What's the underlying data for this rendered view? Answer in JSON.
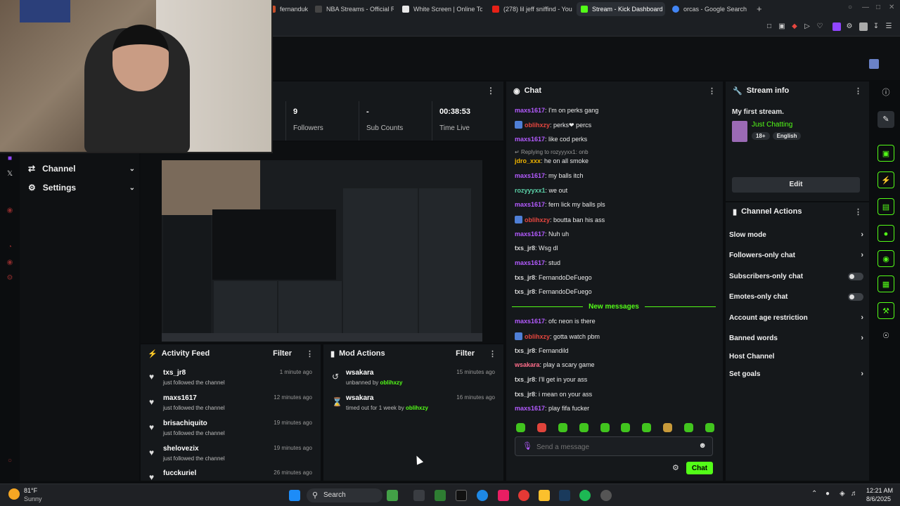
{
  "browser": {
    "tabs": [
      {
        "label": "fernanduk",
        "color": "#c74f2b"
      },
      {
        "label": "NBA Streams - Official Re",
        "color": "#333"
      },
      {
        "label": "White Screen | Online To",
        "color": "#e8e8e8"
      },
      {
        "label": "(278) lil jeff sniffind - You",
        "color": "#e62117"
      },
      {
        "label": "Stream - Kick Dashboard",
        "color": "#53fc18"
      },
      {
        "label": "orcas - Google Search",
        "color": "#4285f4"
      }
    ],
    "new_tab": "+"
  },
  "sidenav": {
    "channel": "Channel",
    "settings": "Settings"
  },
  "stats": [
    {
      "value": "9",
      "label": "Followers"
    },
    {
      "value": "-",
      "label": "Sub Counts"
    },
    {
      "value": "00:38:53",
      "label": "Time Live"
    }
  ],
  "activity_feed": {
    "title": "Activity Feed",
    "filter": "Filter",
    "items": [
      {
        "name": "txs_jr8",
        "sub": "just followed the channel",
        "time": "1 minute ago"
      },
      {
        "name": "maxs1617",
        "sub": "just followed the channel",
        "time": "12 minutes ago"
      },
      {
        "name": "brisachiquito",
        "sub": "just followed the channel",
        "time": "19 minutes ago"
      },
      {
        "name": "shelovezix",
        "sub": "just followed the channel",
        "time": "19 minutes ago"
      },
      {
        "name": "fucckuriel",
        "sub": "",
        "time": "26 minutes ago"
      }
    ]
  },
  "mod_actions": {
    "title": "Mod Actions",
    "filter": "Filter",
    "items": [
      {
        "name": "wsakara",
        "action": "unbanned by",
        "by": "oblihxzy",
        "time": "15 minutes ago"
      },
      {
        "name": "wsakara",
        "action": "timed out for 1 week by",
        "by": "oblihxzy",
        "time": "16 minutes ago"
      }
    ]
  },
  "chat": {
    "title": "Chat",
    "new_messages": "New messages",
    "reply_note": "Replying to rozyyyxx1: onb",
    "placeholder": "Send a message",
    "send_label": "Chat",
    "messages": [
      {
        "user": "maxs1617",
        "text": ": I'm on perks gang",
        "color": "#b45bff",
        "badge": false
      },
      {
        "user": "oblihxzy",
        "text": ": perks❤ percs",
        "color": "#e6463f",
        "badge": true
      },
      {
        "user": "maxs1617",
        "text": ": like cod perks",
        "color": "#b45bff",
        "badge": false
      },
      {
        "user": "jdro_xxx",
        "text": ": he on all smoke",
        "color": "#f0b400",
        "badge": false
      },
      {
        "user": "maxs1617",
        "text": ": my balls itch",
        "color": "#b45bff",
        "badge": false
      },
      {
        "user": "rozyyyxx1",
        "text": ": we out",
        "color": "#5bd1a8",
        "badge": false
      },
      {
        "user": "maxs1617",
        "text": ": fern lick my balls pls",
        "color": "#b45bff",
        "badge": false
      },
      {
        "user": "oblihxzy",
        "text": ": boutta ban his ass",
        "color": "#e6463f",
        "badge": true
      },
      {
        "user": "maxs1617",
        "text": ": Nuh uh",
        "color": "#b45bff",
        "badge": false
      },
      {
        "user": "txs_jr8",
        "text": ": Wsg dl",
        "color": "#d9d9d9",
        "badge": false
      },
      {
        "user": "maxs1617",
        "text": ": stud",
        "color": "#b45bff",
        "badge": false
      },
      {
        "user": "txs_jr8",
        "text": ": FernandoDeFuego",
        "color": "#d9d9d9",
        "badge": false
      },
      {
        "user": "txs_jr8",
        "text": ": FernandoDeFuego",
        "color": "#d9d9d9",
        "badge": false
      },
      {
        "user": "maxs1617",
        "text": ": ofc neon is there",
        "color": "#b45bff",
        "badge": false
      },
      {
        "user": "oblihxzy",
        "text": ": gotta watch pbm",
        "color": "#e6463f",
        "badge": true
      },
      {
        "user": "txs_jr8",
        "text": ": Fernandild",
        "color": "#d9d9d9",
        "badge": false
      },
      {
        "user": "wsakara",
        "text": ": play a scary game",
        "color": "#ff6d8a",
        "badge": false
      },
      {
        "user": "txs_jr8",
        "text": ": I'll get in your ass",
        "color": "#d9d9d9",
        "badge": false
      },
      {
        "user": "txs_jr8",
        "text": ": i mean on your ass",
        "color": "#d9d9d9",
        "badge": false
      },
      {
        "user": "maxs1617",
        "text": ": play fifa fucker",
        "color": "#b45bff",
        "badge": false
      }
    ]
  },
  "stream_info": {
    "title": "Stream info",
    "stream_title": "My first stream.",
    "category": "Just Chatting",
    "tags": [
      "18+",
      "English"
    ],
    "edit": "Edit"
  },
  "channel_actions": {
    "title": "Channel Actions",
    "items": [
      {
        "label": "Slow mode",
        "kind": "chevron"
      },
      {
        "label": "Followers-only chat",
        "kind": "chevron"
      },
      {
        "label": "Subscribers-only chat",
        "kind": "toggle"
      },
      {
        "label": "Emotes-only chat",
        "kind": "toggle"
      },
      {
        "label": "Account age restriction",
        "kind": "chevron"
      },
      {
        "label": "Banned words",
        "kind": "chevron"
      },
      {
        "label": "Host Channel",
        "kind": "none"
      },
      {
        "label": "Set goals",
        "kind": "chevron"
      }
    ]
  },
  "taskbar": {
    "weather_temp": "81°F",
    "weather_desc": "Sunny",
    "search": "Search",
    "time": "12:21 AM",
    "date": "8/6/2025"
  },
  "colors": {
    "accent": "#53fc18",
    "panel": "#15181b",
    "background": "#0b0d0f"
  }
}
